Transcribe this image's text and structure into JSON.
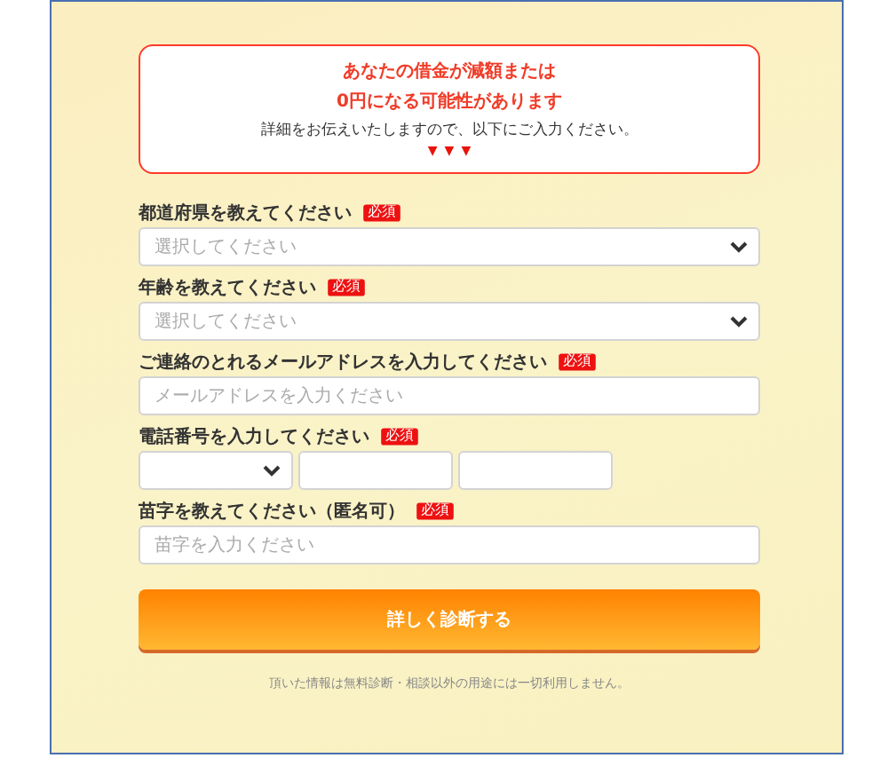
{
  "notice": {
    "headline": [
      "あなたの借金が減額または",
      "0円になる可能性があります"
    ],
    "text": "詳細をお伝えいたしますので、以下にご入力ください。",
    "arrows": [
      "▼",
      "▼",
      "▼"
    ]
  },
  "fields": [
    {
      "kind": "select",
      "label": "都道府県を教えてください",
      "badge": "必須",
      "placeholder": "選択してください"
    },
    {
      "kind": "select",
      "label": "年齢を教えてください",
      "badge": "必須",
      "placeholder": "選択してください"
    },
    {
      "kind": "input",
      "label": "ご連絡のとれるメールアドレスを入力してください",
      "badge": "必須",
      "placeholder": "メールアドレスを入力ください"
    },
    {
      "kind": "phone",
      "label": "電話番号を入力してください",
      "badge": "必須"
    },
    {
      "kind": "input",
      "label": "苗字を教えてください（匿名可）",
      "badge": "必須",
      "placeholder": "苗字を入力ください"
    }
  ],
  "submit": "詳しく診断する",
  "footnote": "頂いた情報は無料診断・相談以外の用途には一切利用しません。"
}
